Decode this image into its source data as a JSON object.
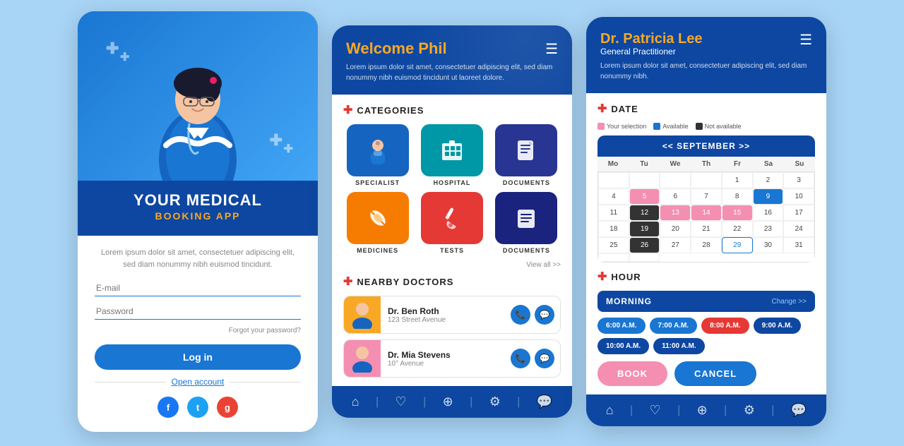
{
  "screen1": {
    "title_line1": "YOUR MEDICAL",
    "title_line2": "BOOKING APP",
    "description": "Lorem ipsum dolor sit amet, consectetuer adipiscing elit, sed diam nonummy nibh euismod tincidunt.",
    "email_placeholder": "E-mail",
    "password_placeholder": "Password",
    "forgot_password": "Forgot your password?",
    "login_label": "Log in",
    "open_account_label": "Open account",
    "social": {
      "facebook": "f",
      "twitter": "t",
      "google": "g"
    }
  },
  "screen2": {
    "header": {
      "welcome": "Welcome Phil",
      "description": "Lorem ipsum dolor sit amet, consectetuer\nadipiscing elit, sed diam nonummy nibh\neuismod tincidunt ut laoreet dolore."
    },
    "categories_title": "CATEGORIES",
    "categories": [
      {
        "label": "SPECIALIST",
        "icon": "👩‍⚕️",
        "color": "cat-blue"
      },
      {
        "label": "HOSPITAL",
        "icon": "🏥",
        "color": "cat-teal"
      },
      {
        "label": "DOCUMENTS",
        "icon": "💊",
        "color": "cat-cobalt"
      },
      {
        "label": "MEDICINES",
        "icon": "💊",
        "color": "cat-orange"
      },
      {
        "label": "TESTS",
        "icon": "💉",
        "color": "cat-red"
      },
      {
        "label": "DOCUMENTS",
        "icon": "📋",
        "color": "cat-navy"
      }
    ],
    "view_all": "View all >>",
    "nearby_title": "NEARBY DOCTORS",
    "doctors": [
      {
        "name": "Dr. Ben Roth",
        "address": "123 Street Avenue",
        "avatar": "👤",
        "avatar_color": "avatar-yellow"
      },
      {
        "name": "Dr. Mia Stevens",
        "address": "10° Avenue",
        "avatar": "👤",
        "avatar_color": "avatar-pink"
      }
    ]
  },
  "screen3": {
    "header": {
      "doctor_name": "Dr. Patricia Lee",
      "specialty": "General Practitioner",
      "description": "Lorem ipsum dolor sit amet, consectetuer\nadipiscing elit, sed diam nonummy nibh."
    },
    "date_title": "DATE",
    "legend": {
      "your_selection": "Your selection",
      "available": "Available",
      "not_available": "Not available"
    },
    "calendar": {
      "month": "<< SEPTEMBER >>",
      "day_headers": [
        "Mo",
        "Tu",
        "We",
        "Th",
        "Fr",
        "Sa",
        "Su"
      ],
      "rows": [
        [
          "",
          "",
          "",
          "",
          "",
          "1",
          "2",
          "3",
          "4",
          "5"
        ],
        [
          "6",
          "7",
          "8",
          "9",
          "10",
          "11",
          "12"
        ],
        [
          "13",
          "14",
          "15",
          "16",
          "17",
          "18",
          "19"
        ],
        [
          "20",
          "21",
          "22",
          "23",
          "24",
          "25",
          "26"
        ],
        [
          "27",
          "28",
          "29",
          "30",
          "31"
        ]
      ]
    },
    "hour_title": "HOUR",
    "morning_label": "MORNING",
    "change_label": "Change >>",
    "time_slots": [
      {
        "time": "6:00 A.M.",
        "style": "slot-blue"
      },
      {
        "time": "7:00 A.M.",
        "style": "slot-blue"
      },
      {
        "time": "8:00 A.M.",
        "style": "slot-pink"
      },
      {
        "time": "9:00 A.M.",
        "style": "slot-dark"
      },
      {
        "time": "10:00 A.M.",
        "style": "slot-dark"
      },
      {
        "time": "11:00 A.M.",
        "style": "slot-dark"
      }
    ],
    "book_label": "BOOK",
    "cancel_label": "CANCEL"
  },
  "background_color": "#a8d4f5"
}
